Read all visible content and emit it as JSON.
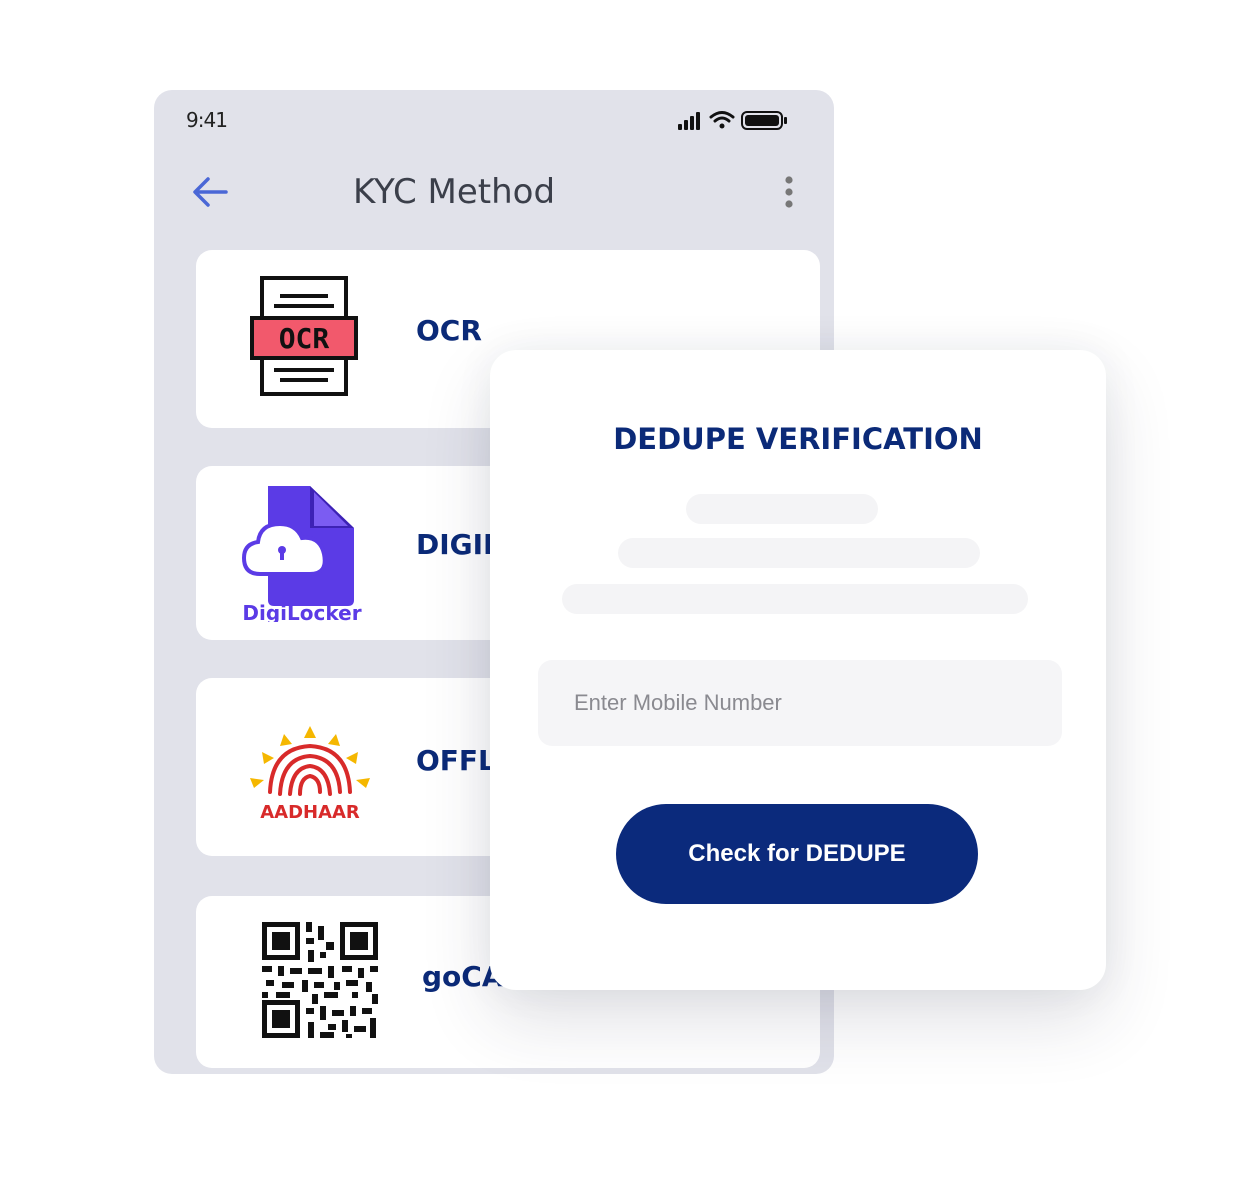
{
  "status_bar": {
    "time": "9:41"
  },
  "header": {
    "title": "KYC Method"
  },
  "methods": [
    {
      "label": "OCR",
      "icon": "ocr-document-icon",
      "icon_text": "OCR"
    },
    {
      "label": "DIGIL",
      "icon": "digilocker-logo",
      "icon_text": "DigiLocker"
    },
    {
      "label": "OFFLI",
      "icon": "aadhaar-logo",
      "icon_text": "AADHAAR"
    },
    {
      "label": "goCA",
      "icon": "qr-code-icon"
    }
  ],
  "dedupe": {
    "title": "DEDUPE VERIFICATION",
    "mobile_placeholder": "Enter Mobile Number",
    "button_label": "Check for DEDUPE"
  },
  "colors": {
    "brand": "#0b2a7c",
    "phone_bg": "#e1e2ea",
    "ocr_highlight": "#f2596c",
    "digilocker": "#5b3be6"
  }
}
